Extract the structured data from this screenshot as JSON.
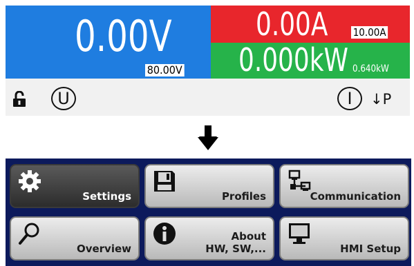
{
  "display": {
    "voltage": {
      "actual": "0.00V",
      "set": "80.00V",
      "color": "#1f7de0"
    },
    "current": {
      "actual": "0.00A",
      "set": "10.00A",
      "color": "#e8262c"
    },
    "power": {
      "actual": "0.000kW",
      "set": "0.640kW",
      "color": "#26b34a"
    },
    "status": {
      "lock_icon": "unlocked-padlock-icon",
      "voltage_mode": "U",
      "current_mode": "I",
      "mode_suffix": "↓P"
    }
  },
  "arrow_icon": "arrow-down-icon",
  "menu": {
    "background": "#0c1a5c",
    "buttons": [
      {
        "label": "Settings",
        "icon": "gear-icon",
        "selected": true
      },
      {
        "label": "Profiles",
        "icon": "floppy-disk-icon"
      },
      {
        "label": "Communication",
        "icon": "network-icon"
      },
      {
        "label": "Overview",
        "icon": "magnifier-icon"
      },
      {
        "label_line1": "About",
        "label_line2": "HW, SW,...",
        "icon": "info-icon"
      },
      {
        "label": "HMI Setup",
        "icon": "monitor-icon"
      }
    ]
  }
}
